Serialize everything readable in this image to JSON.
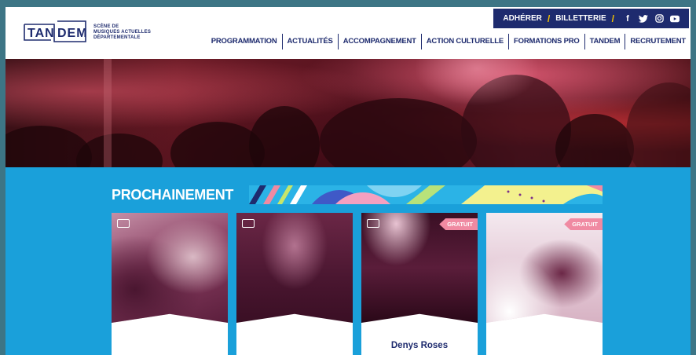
{
  "logo": {
    "name_left": "TAN",
    "name_right": "DEM",
    "subtitle_lines": [
      "SCÈNE DE",
      "MUSIQUES ACTUELLES",
      "DÉPARTEMENTALE"
    ]
  },
  "topbar": {
    "adherer": "ADHÉRER",
    "separator": "/",
    "billetterie": "BILLETTERIE",
    "social": [
      {
        "icon": "facebook-icon",
        "glyph": "f"
      },
      {
        "icon": "twitter-icon",
        "glyph": "🐦"
      },
      {
        "icon": "instagram-icon",
        "glyph": "◎"
      },
      {
        "icon": "youtube-icon",
        "glyph": "▶"
      }
    ]
  },
  "nav": {
    "items": [
      {
        "label": "PROGRAMMATION"
      },
      {
        "label": "ACTUALITÉS"
      },
      {
        "label": "ACCOMPAGNEMENT"
      },
      {
        "label": "ACTION CULTURELLE"
      },
      {
        "label": "FORMATIONS PRO"
      },
      {
        "label": "TANDEM"
      },
      {
        "label": "RECRUTEMENT"
      }
    ]
  },
  "section": {
    "title": "PROCHAINEMENT"
  },
  "cards": [
    {
      "badge": "",
      "title": ""
    },
    {
      "badge": "",
      "title": ""
    },
    {
      "badge": "GRATUIT",
      "title": "Denys Roses"
    },
    {
      "badge": "GRATUIT",
      "title": ""
    }
  ],
  "colors": {
    "brand_navy": "#1e2b6e",
    "accent_yellow": "#f5c400",
    "background_blue": "#1aa0da",
    "badge_pink": "#f08aa2"
  }
}
